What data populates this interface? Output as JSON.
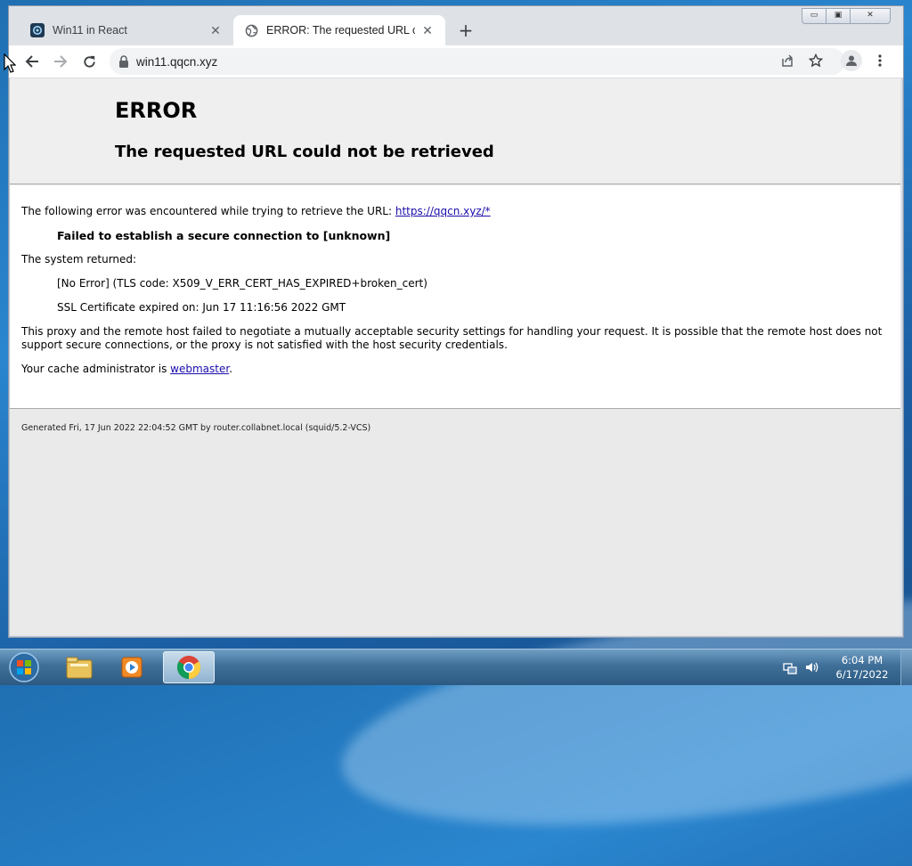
{
  "browser": {
    "tabs": [
      {
        "title": "Win11 in React",
        "active": false
      },
      {
        "title": "ERROR: The requested URL could not be retrieved",
        "active": true
      }
    ],
    "new_tab_symbol": "+",
    "address": "win11.qqcn.xyz",
    "window_controls": {
      "minimize": "minimize-icon",
      "maximize": "maximize-icon",
      "close": "close-icon"
    }
  },
  "page": {
    "heading": "ERROR",
    "subheading": "The requested URL could not be retrieved",
    "intro_text": "The following error was encountered while trying to retrieve the URL: ",
    "intro_link": "https://qqcn.xyz/*",
    "failure": "Failed to establish a secure connection to [unknown]",
    "system_returned": "The system returned:",
    "tls_error": "[No Error] (TLS code: X509_V_ERR_CERT_HAS_EXPIRED+broken_cert)",
    "cert_expired": "SSL Certificate expired on: Jun 17 11:16:56 2022 GMT",
    "explanation": "This proxy and the remote host failed to negotiate a mutually acceptable security settings for handling your request. It is possible that the remote host does not support secure connections, or the proxy is not satisfied with the host security credentials.",
    "admin_text": "Your cache administrator is ",
    "admin_link": "webmaster",
    "admin_end": ".",
    "footer": "Generated Fri, 17 Jun 2022 22:04:52 GMT by router.collabnet.local (squid/5.2-VCS)"
  },
  "taskbar": {
    "items": [
      "windows-explorer",
      "media-player",
      "chrome"
    ],
    "time": "6:04 PM",
    "date": "6/17/2022"
  },
  "colors": {
    "link": "#1a0dab",
    "desktop": "#2a86cf"
  }
}
